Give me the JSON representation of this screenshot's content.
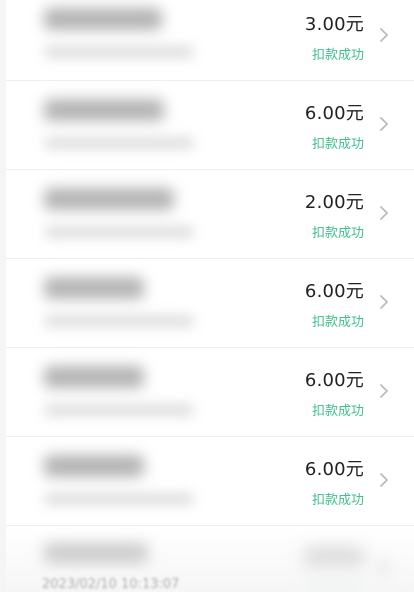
{
  "records": [
    {
      "amount": "3.00元",
      "status": "扣款成功"
    },
    {
      "amount": "6.00元",
      "status": "扣款成功"
    },
    {
      "amount": "2.00元",
      "status": "扣款成功"
    },
    {
      "amount": "6.00元",
      "status": "扣款成功"
    },
    {
      "amount": "6.00元",
      "status": "扣款成功"
    },
    {
      "amount": "6.00元",
      "status": "扣款成功"
    }
  ],
  "partial_row": {
    "timestamp": "2023/02/10 10:13:07"
  },
  "colors": {
    "status": "#3fbf8a",
    "amount": "#222222",
    "chevron": "#bbbbbb",
    "background": "#f5f5f5"
  },
  "icons": {
    "chevron": "chevron-right-icon"
  }
}
